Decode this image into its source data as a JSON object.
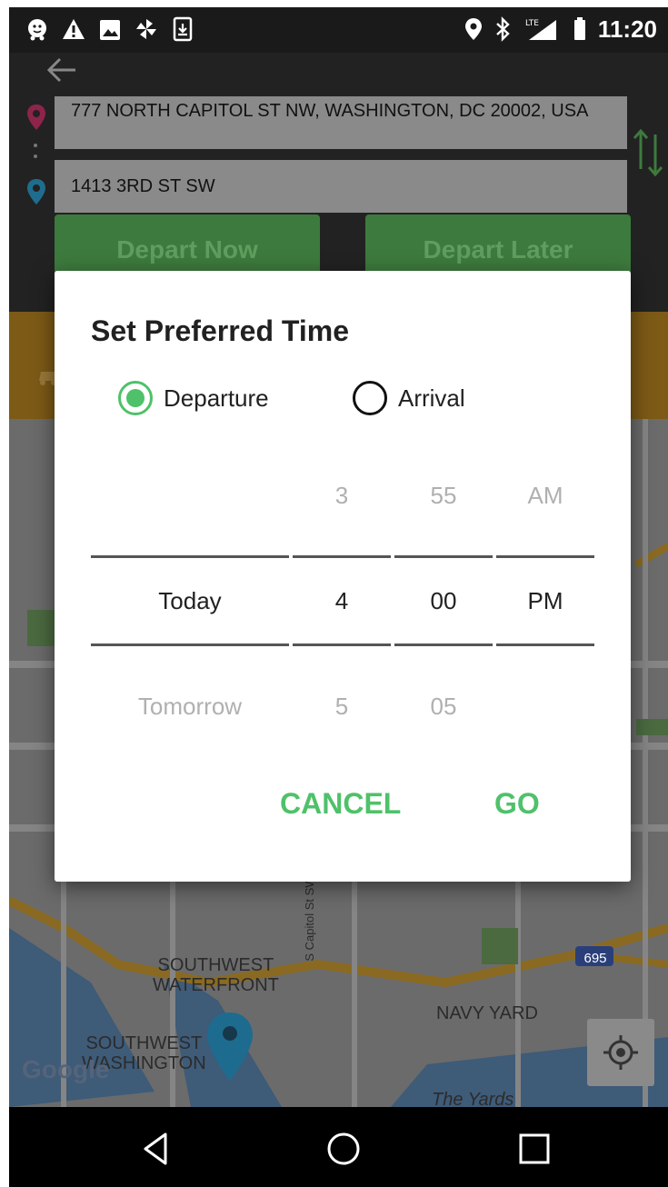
{
  "status_bar": {
    "time": "11:20",
    "icons": [
      "waze-icon",
      "warning-icon",
      "image-icon",
      "pinwheel-icon",
      "download-icon",
      "location-icon",
      "bluetooth-icon",
      "lte-signal-icon",
      "battery-icon"
    ]
  },
  "header": {
    "origin": "777 NORTH CAPITOL ST NW, WASHINGTON, DC 20002, USA",
    "destination": "1413 3RD ST SW",
    "depart_now": "Depart Now",
    "depart_later": "Depart Later"
  },
  "map": {
    "labels": {
      "southwest_waterfront": "SOUTHWEST\nWATERFRONT",
      "southwest_washington": "SOUTHWEST\nWASHINGTON",
      "navy_yard": "NAVY YARD",
      "the_yards": "The Yards",
      "street": "S Capitol St SW",
      "shield": "695"
    },
    "google": "Google"
  },
  "dialog": {
    "title": "Set Preferred Time",
    "radio_departure": "Departure",
    "radio_arrival": "Arrival",
    "selected": "Departure",
    "day_col": {
      "prev": "",
      "current": "Today",
      "next": "Tomorrow"
    },
    "hour_col": {
      "prev": "3",
      "current": "4",
      "next": "5"
    },
    "minute_col": {
      "prev": "55",
      "current": "00",
      "next": "05"
    },
    "ampm_col": {
      "prev": "AM",
      "current": "PM",
      "next": ""
    },
    "cancel": "CANCEL",
    "go": "GO"
  },
  "colors": {
    "accent": "#4fc16a",
    "button_green": "#3d7a3d",
    "header_bg": "#222222"
  }
}
